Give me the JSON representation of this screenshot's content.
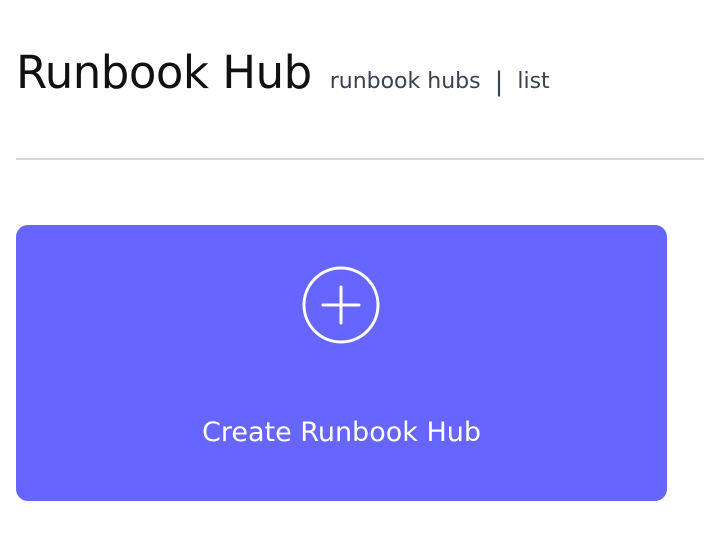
{
  "header": {
    "title": "Runbook Hub",
    "breadcrumb": [
      {
        "label": "runbook hubs"
      },
      {
        "label": "list"
      }
    ],
    "separator": "|"
  },
  "create_card": {
    "label": "Create Runbook Hub",
    "icon": "plus-circle-icon",
    "background_color": "#6666ff",
    "text_color": "#ffffff"
  }
}
